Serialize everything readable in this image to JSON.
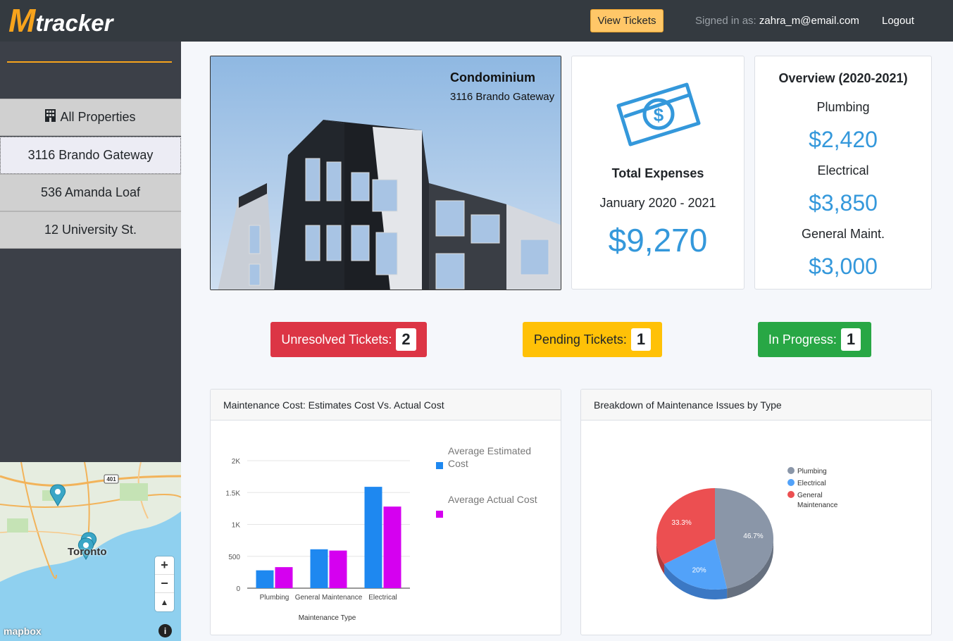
{
  "header": {
    "logo_m": "M",
    "logo_rest": "tracker",
    "view_tickets": "View Tickets",
    "signed_in_label": "Signed in as:",
    "email": "zahra_m@email.com",
    "logout": "Logout"
  },
  "sidebar": {
    "items": [
      {
        "label": "All Properties"
      },
      {
        "label": "3116 Brando Gateway"
      },
      {
        "label": "536 Amanda Loaf"
      },
      {
        "label": "12 University St."
      }
    ]
  },
  "map": {
    "city_label": "Toronto",
    "highway_label": "401",
    "attribution": "mapbox",
    "zoom_in": "+",
    "zoom_out": "−",
    "compass": "▲",
    "info": "i"
  },
  "property": {
    "type": "Condominium",
    "address": "3116 Brando Gateway"
  },
  "expenses": {
    "title": "Total Expenses",
    "period": "January 2020 - 2021",
    "total": "$9,270"
  },
  "overview": {
    "title": "Overview (2020-2021)",
    "items": [
      {
        "label": "Plumbing",
        "value": "$2,420"
      },
      {
        "label": "Electrical",
        "value": "$3,850"
      },
      {
        "label": "General Maint.",
        "value": "$3,000"
      }
    ]
  },
  "tickets": {
    "unresolved_label": "Unresolved Tickets:",
    "unresolved_count": "2",
    "pending_label": "Pending Tickets:",
    "pending_count": "1",
    "progress_label": "In Progress:",
    "progress_count": "1"
  },
  "colors": {
    "accent": "#f7a31c",
    "money_blue": "#3498db",
    "estimated": "#1e88f0",
    "actual": "#d500f0"
  },
  "chart_data": [
    {
      "type": "bar",
      "title": "Maintenance Cost: Estimates Cost Vs. Actual Cost",
      "categories": [
        "Plumbing",
        "General Maintenance",
        "Electrical"
      ],
      "series": [
        {
          "name": "Average Estimated Cost",
          "values": [
            280,
            610,
            1590
          ],
          "color": "#1e88f0"
        },
        {
          "name": "Average Actual Cost",
          "values": [
            330,
            590,
            1280
          ],
          "color": "#d500f0"
        }
      ],
      "xlabel": "Maintenance Type",
      "ylabel": "",
      "ylim": [
        0,
        2000
      ],
      "yticks": [
        "0",
        "500",
        "1K",
        "1.5K",
        "2K"
      ],
      "legend": "right"
    },
    {
      "type": "pie",
      "title": "Breakdown of Maintenance Issues by Type",
      "slices": [
        {
          "name": "Plumbing",
          "value": 46.7,
          "label": "46.7%",
          "color": "#8a96a8"
        },
        {
          "name": "Electrical",
          "value": 20,
          "label": "20%",
          "color": "#52a2f9"
        },
        {
          "name": "General Maintenance",
          "value": 33.3,
          "label": "33.3%",
          "color": "#ec4f51"
        }
      ],
      "legend": "right"
    }
  ]
}
